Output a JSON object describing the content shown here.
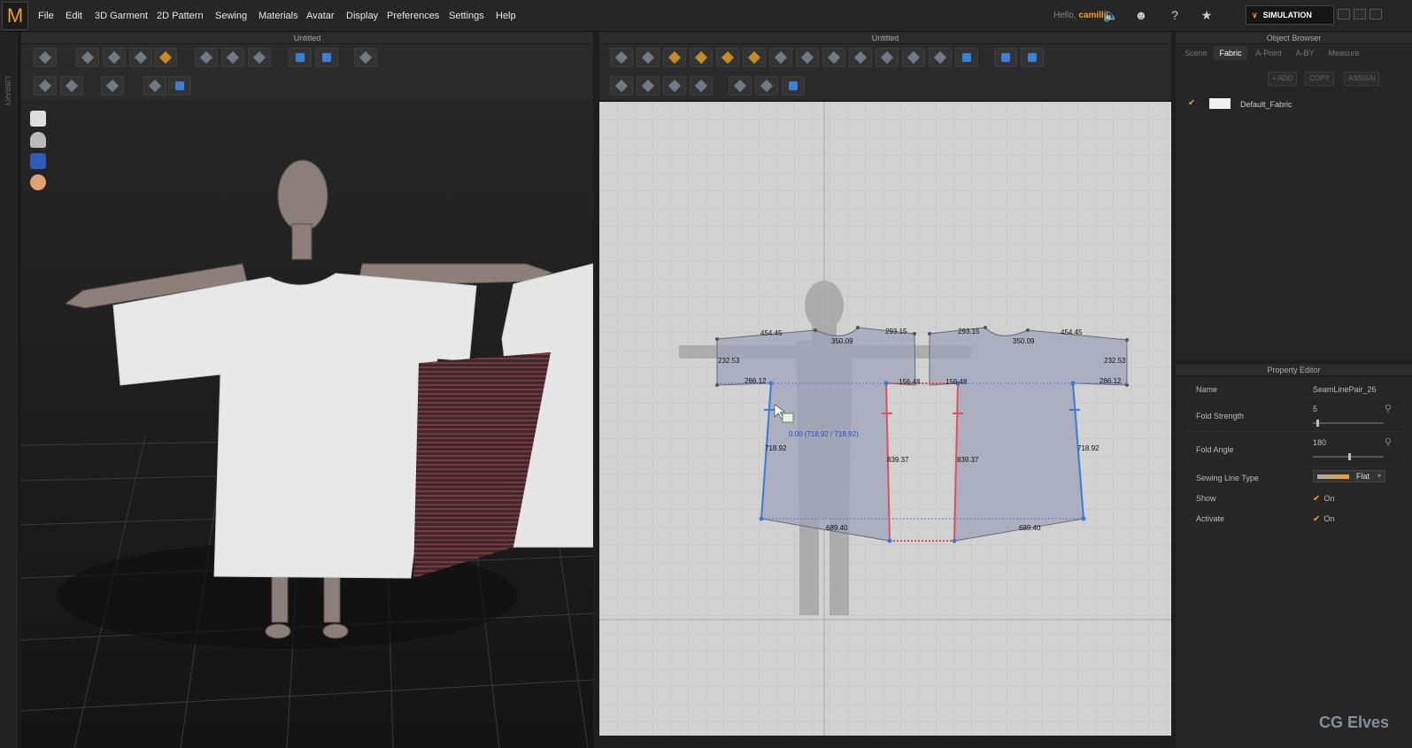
{
  "app": {
    "logo": "M",
    "menu": [
      "File",
      "Edit",
      "3D Garment",
      "2D Pattern",
      "Sewing",
      "Materials",
      "Avatar",
      "Display",
      "Preferences",
      "Settings",
      "Help"
    ],
    "greeting": "Hello,",
    "username": "camilli",
    "simulation_label": "SIMULATION",
    "library_label": "LIBRARY"
  },
  "panels": {
    "left_title": "Untitled",
    "right_title": "Untitled"
  },
  "object_browser": {
    "title": "Object Browser",
    "tabs": [
      "Scene",
      "Fabric",
      "A-Point",
      "A-BY",
      "Measure"
    ],
    "active_tab": "Fabric",
    "actions": [
      "+ ADD",
      "COPY",
      "ASSIGN"
    ],
    "items": [
      {
        "name": "Default_Fabric",
        "color": "#f0f0f0",
        "checked": true
      }
    ]
  },
  "property_editor": {
    "title": "Property Editor",
    "rows": [
      {
        "label": "Name",
        "value": "SeamLinePair_26"
      },
      {
        "label": "Fold Strength",
        "value": "5"
      },
      {
        "label": "Fold Angle",
        "value": "180"
      },
      {
        "label": "Sewing Line Type",
        "value": "Flat"
      },
      {
        "label": "Show",
        "value": "On"
      },
      {
        "label": "Activate",
        "value": "On"
      }
    ],
    "sliders": {
      "fold_strength": 0.05,
      "fold_angle": 0.5
    }
  },
  "pattern": {
    "labels": {
      "sleeve_top_left": "454.45",
      "shoulder_left": "293.15",
      "neck_left": "350.09",
      "side_left": "232.53",
      "cuff_left": "286.12",
      "mid_left": "156.48",
      "sleeve_top_right": "454.45",
      "shoulder_right": "293.15",
      "neck_right": "350.09",
      "side_right": "232.53",
      "cuff_right": "286.12",
      "mid_right": "156.48",
      "body_side_left": "718.92",
      "body_side_right": "718.92",
      "center_left": "839.37",
      "center_right": "839.37",
      "hem_left": "689.40",
      "hem_right": "689.40",
      "tooltip": "0.00 (718.92 / 718.92)"
    }
  },
  "watermark": "CG Elves",
  "colors": {
    "accent": "#f0a020",
    "seam_red": "#e0505a",
    "seam_blue": "#3a7ad8",
    "pattern_fill": "#9ea3b8"
  }
}
